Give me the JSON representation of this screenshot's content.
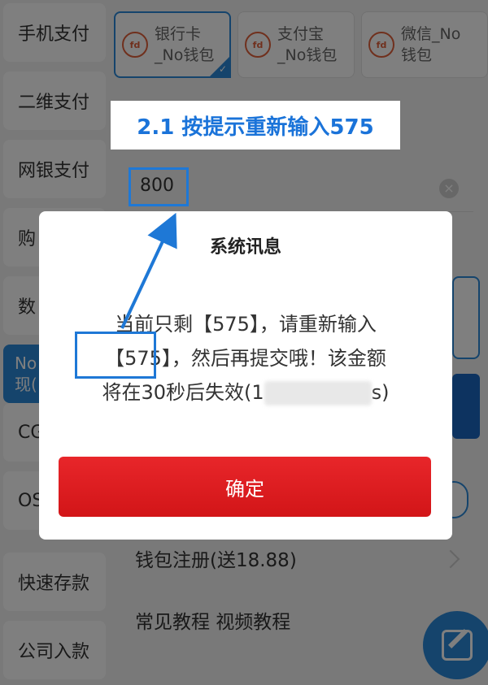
{
  "sidebar": {
    "items": [
      {
        "label": "手机支付"
      },
      {
        "label": "二维支付"
      },
      {
        "label": "网银支付"
      },
      {
        "label": "购"
      },
      {
        "label": "数"
      },
      {
        "label": "No\n现("
      },
      {
        "label": "CG"
      },
      {
        "label": "OS"
      },
      {
        "label": "快速存款"
      },
      {
        "label": "公司入款"
      }
    ]
  },
  "payment_tabs": [
    {
      "icon_text": "fd",
      "label": "银行卡\n_No钱包",
      "selected": true
    },
    {
      "icon_text": "fd",
      "label": "支付宝\n_No钱包",
      "selected": false
    },
    {
      "icon_text": "fd",
      "label": "微信_No\n钱包",
      "selected": false
    }
  ],
  "amount_input": {
    "value": "800"
  },
  "bottom_links": {
    "wallet_register": "钱包注册(送18.88)",
    "tutorials": "常见教程 视频教程"
  },
  "callout": {
    "text": "2.1 按提示重新输入575"
  },
  "modal": {
    "title": "系统讯息",
    "message_line1": "当前只剩【575】，请重新输入",
    "message_line2": "【575】，然后再提交哦！该金额",
    "message_line3_prefix": "将在30秒后失效(1",
    "message_line3_suffix": "s)",
    "confirm_label": "确定"
  },
  "colors": {
    "accent": "#2a88d8",
    "confirm": "#e0191d",
    "annotation": "#1e78d6"
  },
  "icons": {
    "clear": "clear-icon",
    "fab": "edit-icon",
    "tab": "fd-logo-icon"
  }
}
